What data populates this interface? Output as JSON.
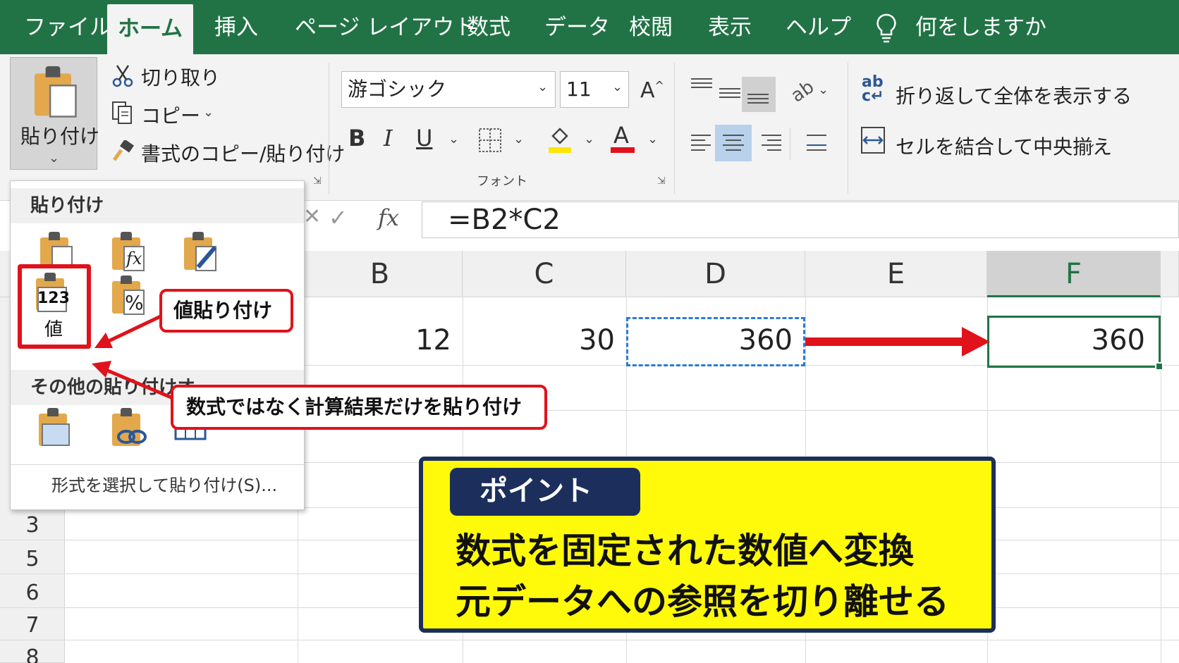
{
  "tabs": [
    {
      "label": "ファイル"
    },
    {
      "label": "ホーム"
    },
    {
      "label": "挿入"
    },
    {
      "label": "ページ レイアウト"
    },
    {
      "label": "数式"
    },
    {
      "label": "データ"
    },
    {
      "label": "校閲"
    },
    {
      "label": "表示"
    },
    {
      "label": "ヘルプ"
    },
    {
      "label": "何をしますか"
    }
  ],
  "clipboard": {
    "paste_label": "貼り付け",
    "cut_label": "切り取り",
    "copy_label": "コピー",
    "format_painter_label": "書式のコピー/貼り付け"
  },
  "font": {
    "name": "游ゴシック",
    "size": "11",
    "bold": "B",
    "italic": "I",
    "underline": "U",
    "grow": "A",
    "color_letter": "A",
    "group_label": "フォント"
  },
  "alignment": {
    "wrap_label": "折り返して全体を表示する",
    "merge_label": "セルを結合して中央揃え"
  },
  "formula_bar": {
    "fx": "fx",
    "formula": "=B2*C2"
  },
  "columns": [
    "B",
    "C",
    "D",
    "E",
    "F"
  ],
  "row2": {
    "B": "12",
    "C": "30",
    "D": "360",
    "F": "360"
  },
  "row_numbers": [
    "3",
    "5",
    "6",
    "7",
    "8"
  ],
  "paste_menu": {
    "header": "貼り付け",
    "values_icon_number": "123",
    "values_icon_label": "値",
    "values_icon_formula": "fx",
    "percent_glyph": "%",
    "other_header": "その他の貼り付けオ",
    "special": "形式を選択して貼り付け(S)..."
  },
  "callouts": {
    "values_paste": "値貼り付け",
    "description": "数式ではなく計算結果だけを貼り付け"
  },
  "point": {
    "badge": "ポイント",
    "line1": "数式を固定された数値へ変換",
    "line2": "元データへの参照を切り離せる"
  },
  "colors": {
    "excel_green": "#217346",
    "highlight_red": "#e0121b",
    "point_yellow": "#fff90a",
    "point_navy": "#1c2f5c",
    "font_color_bar": "#e0121b",
    "fill_color_bar": "#ffe600"
  }
}
